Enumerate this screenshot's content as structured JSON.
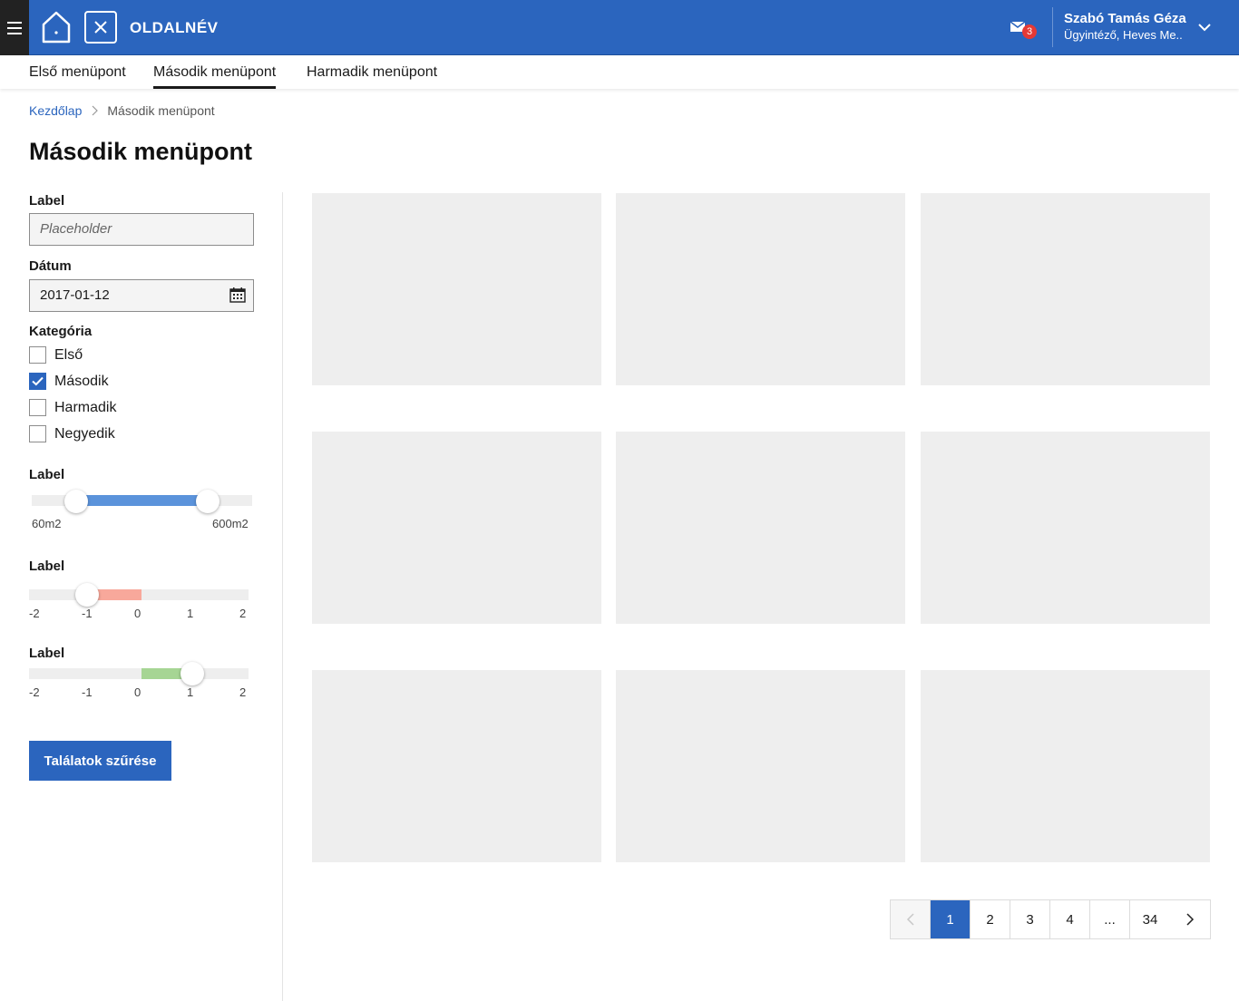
{
  "header": {
    "page_name": "OLDALNÉV",
    "mail_count": "3",
    "user_name": "Szabó Tamás Géza",
    "user_role": "Ügyintéző, Heves Me..",
    "brand_color": "#2b65be"
  },
  "nav": {
    "items": [
      "Első menüpont",
      "Második menüpont",
      "Harmadik menüpont"
    ],
    "active_index": 1
  },
  "breadcrumb": {
    "home": "Kezdőlap",
    "current": "Második menüpont"
  },
  "page_title": "Második menüpont",
  "filters": {
    "text_field": {
      "label": "Label",
      "placeholder": "Placeholder",
      "value": ""
    },
    "date_field": {
      "label": "Dátum",
      "value": "2017-01-12"
    },
    "category": {
      "label": "Kategória",
      "options": [
        {
          "label": "Első",
          "checked": false
        },
        {
          "label": "Második",
          "checked": true
        },
        {
          "label": "Harmadik",
          "checked": false
        },
        {
          "label": "Negyedik",
          "checked": false
        }
      ]
    },
    "range_slider": {
      "label": "Label",
      "min_label": "60m2",
      "max_label": "600m2",
      "low_fraction": 0.2,
      "high_fraction": 0.8,
      "color": "#5b93db"
    },
    "negative_slider": {
      "label": "Label",
      "ticks": [
        "-2",
        "-1",
        "0",
        "1",
        "2"
      ],
      "value": -1,
      "color": "#f8a89b"
    },
    "positive_slider": {
      "label": "Label",
      "ticks": [
        "-2",
        "-1",
        "0",
        "1",
        "2"
      ],
      "value": 1,
      "color": "#a6d594"
    },
    "submit_label": "Találatok szűrése"
  },
  "results": {
    "card_count": 9
  },
  "pagination": {
    "pages": [
      "1",
      "2",
      "3",
      "4",
      "...",
      "34"
    ],
    "current": "1"
  }
}
